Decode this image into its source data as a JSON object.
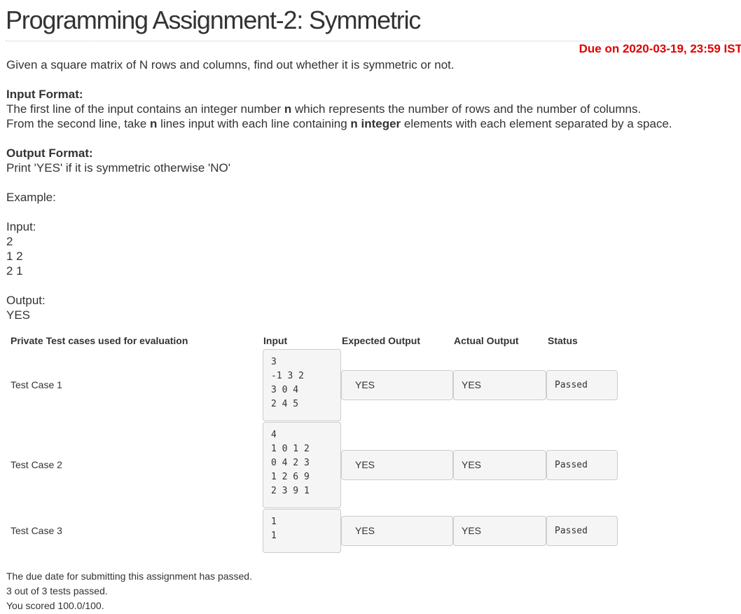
{
  "title": "Programming Assignment-2: Symmetric",
  "due": "Due on 2020-03-19, 23:59 IST",
  "description": "Given a square matrix of N rows and columns, find out whether it is symmetric or not.",
  "input_format": {
    "heading": "Input Format:",
    "line1": {
      "pre": "The first line of the input contains an integer number ",
      "bold": "n",
      "post": " which represents the number of rows and the number of columns."
    },
    "line2": {
      "pre": "From the second line, take ",
      "bold1": "n",
      "mid": " lines input with each line containing ",
      "bold2": "n integer",
      "post": " elements with each element separated by a space."
    }
  },
  "output_format": {
    "heading": "Output Format:",
    "text": "Print 'YES' if it is symmetric otherwise 'NO'"
  },
  "example": {
    "label": "Example:",
    "input_label": "Input:",
    "input_lines": [
      "2",
      "1 2",
      "2 1"
    ],
    "output_label": "Output:",
    "output": "YES"
  },
  "table": {
    "headers": {
      "section": "Private Test cases used for evaluation",
      "input": "Input",
      "expected": "Expected Output",
      "actual": "Actual Output",
      "status": "Status"
    },
    "rows": [
      {
        "label": "Test Case 1",
        "input_lines": [
          "3",
          "-1 3 2",
          "3 0 4",
          "2 4 5"
        ],
        "expected": "YES",
        "actual": "YES",
        "status": "Passed"
      },
      {
        "label": "Test Case 2",
        "input_lines": [
          "4",
          "1 0 1 2",
          "0 4 2 3",
          "1 2 6 9",
          "2 3 9 1"
        ],
        "expected": "YES",
        "actual": "YES",
        "status": "Passed"
      },
      {
        "label": "Test Case 3",
        "input_lines": [
          "1",
          "1"
        ],
        "expected": "YES",
        "actual": "YES",
        "status": "Passed"
      }
    ]
  },
  "footer": {
    "line1": "The due date for submitting this assignment has passed.",
    "line2": "3 out of 3 tests passed.",
    "line3": "You scored 100.0/100."
  },
  "colors": {
    "due": "#e00000",
    "box_bg": "#f5f5f5",
    "box_border": "#cccccc",
    "text": "#333333"
  }
}
